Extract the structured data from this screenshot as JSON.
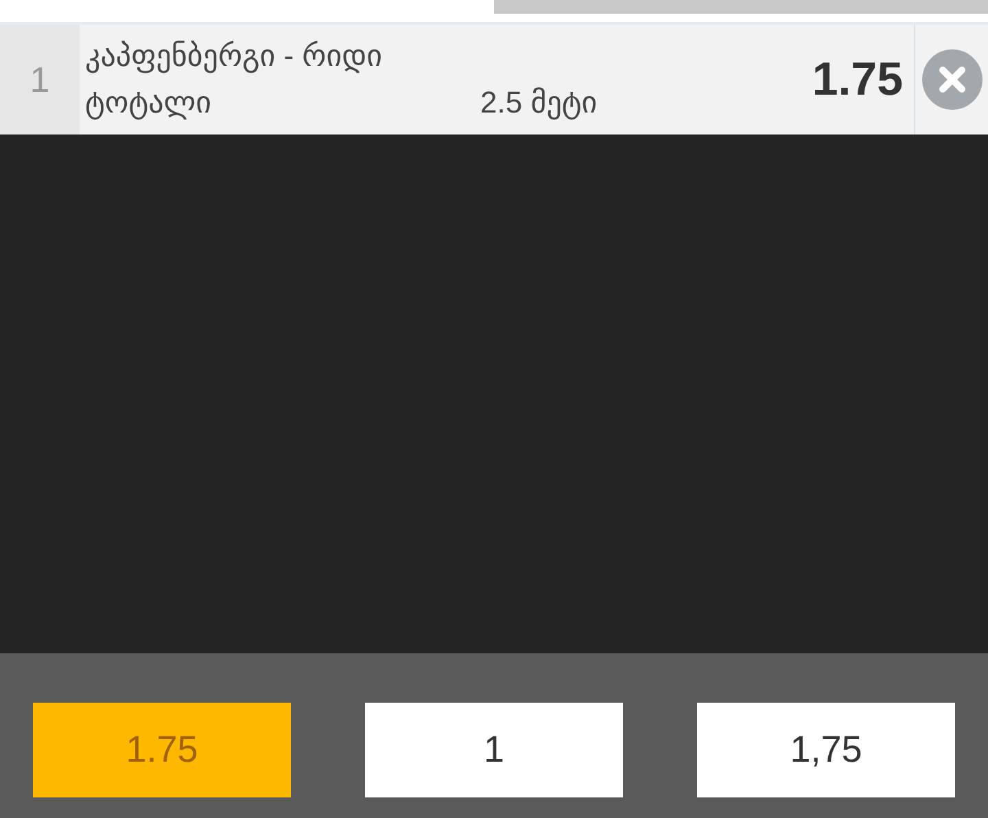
{
  "bet": {
    "index": "1",
    "match": "კაპფენბერგი - რიდი",
    "market": "ტოტალი",
    "selection": "2.5 მეტი",
    "odds": "1.75"
  },
  "options": [
    {
      "label": "1.75",
      "selected": true
    },
    {
      "label": "1",
      "selected": false
    },
    {
      "label": "1,75",
      "selected": false
    }
  ]
}
